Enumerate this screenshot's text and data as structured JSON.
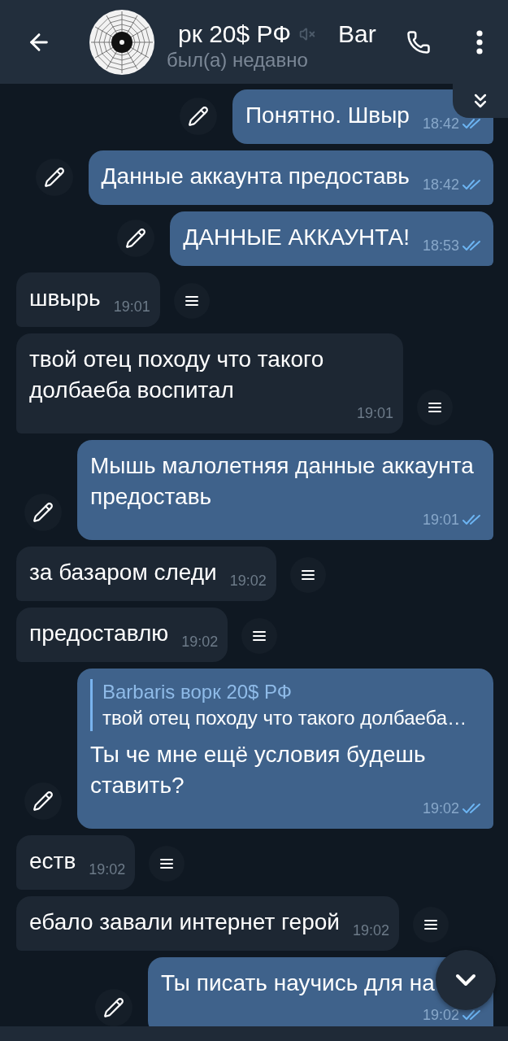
{
  "header": {
    "title": "рк 20$ РФ",
    "muted": true,
    "title_continuation": "Bar",
    "status": "был(а) недавно"
  },
  "messages": [
    {
      "kind": "outgoing",
      "text": "Понятно. Швыр",
      "time": "18:42",
      "read": true,
      "covered": false
    },
    {
      "kind": "outgoing",
      "text": "Данные аккаунта предоставь",
      "time": "18:42",
      "read": true,
      "covered": false
    },
    {
      "kind": "outgoing",
      "text": "ДАННЫЕ АККАУНТА!",
      "time": "18:53",
      "read": true,
      "covered": false
    },
    {
      "kind": "incoming",
      "text": "швырь",
      "time": "19:01",
      "covered": false
    },
    {
      "kind": "incoming",
      "text": "твой отец походу что такого долбаеба воспитал",
      "time": "19:01",
      "covered": false
    },
    {
      "kind": "outgoing",
      "text": "Мышь малолетняя данные аккаунта предоставь",
      "time": "19:01",
      "read": true,
      "covered": false
    },
    {
      "kind": "incoming",
      "text": "за базаром следи",
      "time": "19:02",
      "covered": false
    },
    {
      "kind": "incoming",
      "text": "предоставлю",
      "time": "19:02",
      "covered": false
    },
    {
      "kind": "outgoing",
      "reply": {
        "author": "Barbaris ворк 20$ РФ",
        "text": "твой отец походу что такого долбаеба…"
      },
      "text": "Ты че мне ещё условия будешь ставить?",
      "time": "19:02",
      "read": true,
      "covered": false
    },
    {
      "kind": "incoming",
      "text": "еств",
      "time": "19:02",
      "covered": false
    },
    {
      "kind": "incoming",
      "text": "ебало завали интернет герой",
      "time": "19:02",
      "covered": false
    },
    {
      "kind": "outgoing",
      "text": "Ты писать научись для на",
      "time": "19:02",
      "read": true,
      "covered": true
    }
  ]
}
